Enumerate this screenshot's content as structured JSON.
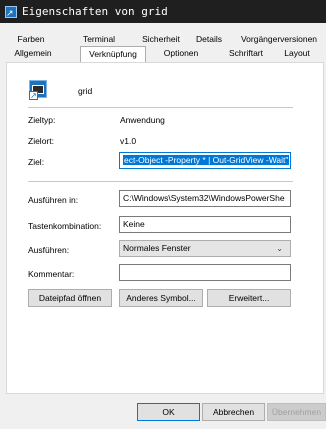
{
  "window": {
    "title": "Eigenschaften von grid"
  },
  "tabs": {
    "row1": [
      "Farben",
      "Terminal",
      "Sicherheit",
      "Details",
      "Vorgängerversionen"
    ],
    "row2": [
      "Allgemein",
      "Verknüpfung",
      "Optionen",
      "Schriftart",
      "Layout"
    ],
    "selected": "Verknüpfung"
  },
  "shortcut": {
    "name": "grid",
    "zieltyp_label": "Zieltyp:",
    "zieltyp_value": "Anwendung",
    "zielort_label": "Zielort:",
    "zielort_value": "v1.0",
    "ziel_label": "Ziel:",
    "ziel_value": "ect-Object -Property * | Out-GridView -Wait\"",
    "ausfuehren_in_label": "Ausführen in:",
    "ausfuehren_in_value": "C:\\Windows\\System32\\WindowsPowerShe",
    "tastenkombination_label": "Tastenkombination:",
    "tastenkombination_value": "Keine",
    "ausfuehren_label": "Ausführen:",
    "ausfuehren_value": "Normales Fenster",
    "kommentar_label": "Kommentar:",
    "kommentar_value": ""
  },
  "buttons": {
    "dateipfad": "Dateipfad öffnen",
    "symbol": "Anderes Symbol...",
    "erweitert": "Erweitert...",
    "ok": "OK",
    "abbrechen": "Abbrechen",
    "uebernehmen": "Übernehmen"
  },
  "icons": {
    "title": "shortcut-app-icon",
    "shortcut": "powershell-shortcut-icon",
    "dropdown": "chevron-down-icon"
  },
  "colors": {
    "accent": "#0078d7",
    "titlebar": "#1f1f1f"
  }
}
